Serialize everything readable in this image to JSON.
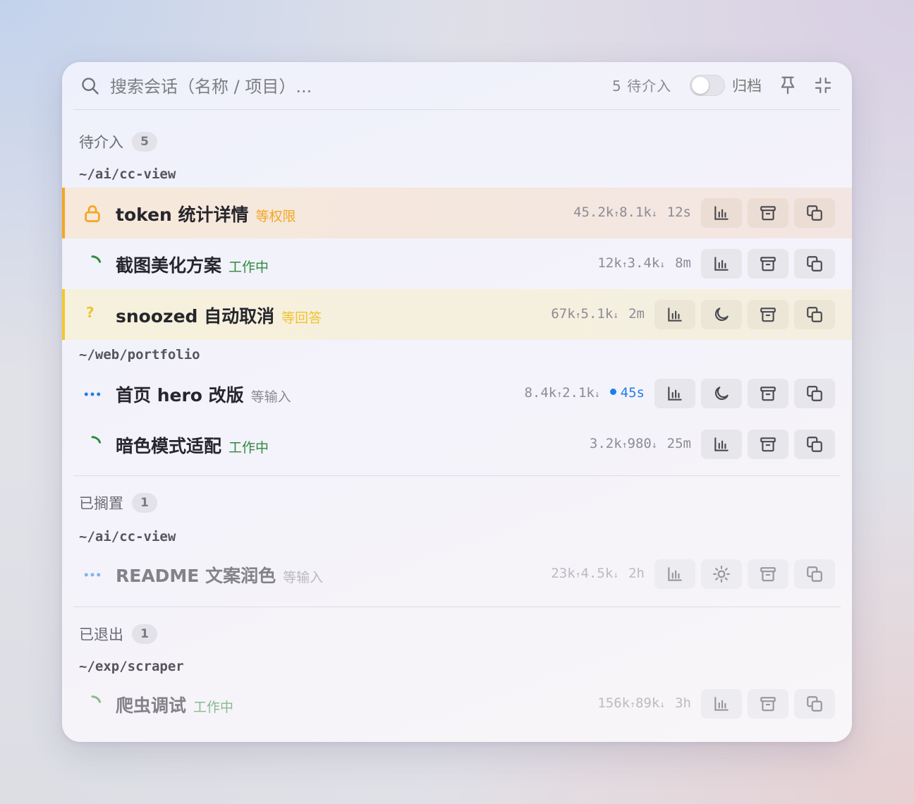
{
  "search": {
    "placeholder": "搜索会话（名称 / 项目）..."
  },
  "header": {
    "pending_count": "5 待介入",
    "archive_toggle_on": false,
    "archive_label": "归档"
  },
  "sections": {
    "pending": {
      "title": "待介入",
      "count": "5"
    },
    "parked": {
      "title": "已搁置",
      "count": "1"
    },
    "exited": {
      "title": "已退出",
      "count": "1"
    }
  },
  "paths": {
    "cc_view": "~/ai/cc-view",
    "portfolio": "~/web/portfolio",
    "cc_view_parked": "~/ai/cc-view",
    "scraper": "~/exp/scraper"
  },
  "sessions": [
    {
      "title": "token 统计详情",
      "status": "等权限",
      "status_color": "#f5a623",
      "tokens_in": "45.2k",
      "tokens_out": "8.1k",
      "age": "12s"
    },
    {
      "title": "截图美化方案",
      "status": "工作中",
      "status_color": "#2e8b3e",
      "tokens_in": "12k",
      "tokens_out": "3.4k",
      "age": "8m"
    },
    {
      "title": "snoozed 自动取消",
      "status": "等回答",
      "status_color": "#f2c230",
      "tokens_in": "67k",
      "tokens_out": "5.1k",
      "age": "2m"
    },
    {
      "title": "首页 hero 改版",
      "status": "等输入",
      "status_color": "#8a8a92",
      "tokens_in": "8.4k",
      "tokens_out": "2.1k",
      "age": "45s"
    },
    {
      "title": "暗色模式适配",
      "status": "工作中",
      "status_color": "#2e8b3e",
      "tokens_in": "3.2k",
      "tokens_out": "980",
      "age": "25m"
    },
    {
      "title": "README 文案润色",
      "status": "等输入",
      "status_color": "#8a8a92",
      "tokens_in": "23k",
      "tokens_out": "4.5k",
      "age": "2h"
    },
    {
      "title": "爬虫调试",
      "status": "工作中",
      "status_color": "#2e8b3e",
      "tokens_in": "156k",
      "tokens_out": "89k",
      "age": "3h"
    }
  ],
  "glyphs": {
    "up": "↑",
    "down": "↓",
    "question": "?"
  },
  "colors": {
    "accent_blue": "#1e7fe8",
    "warn_orange": "#f5a623",
    "answer_yellow": "#f2c230",
    "working_green": "#2e8b3e"
  }
}
